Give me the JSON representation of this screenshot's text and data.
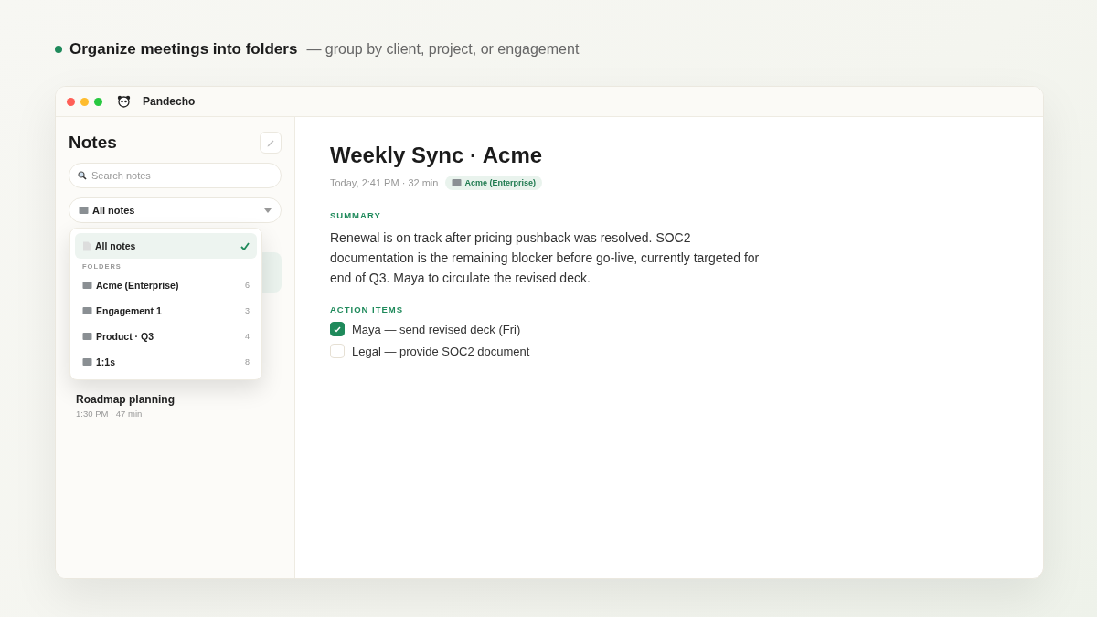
{
  "headline": {
    "title": "Organize meetings into folders",
    "subtitle": "— group by client, project, or engagement"
  },
  "window": {
    "title": "Pandecho"
  },
  "sidebar": {
    "title": "Notes",
    "search": {
      "placeholder": "Search notes"
    },
    "filter": {
      "value": "All notes",
      "expanded": true
    },
    "notes": [
      {
        "title": "Roadmap planning",
        "meta": "1:30 PM · 47 min"
      }
    ]
  },
  "dropdown": {
    "all": {
      "label": "All notes",
      "selected": true
    },
    "section": "FOLDERS",
    "folders": [
      {
        "label": "Acme (Enterprise)",
        "count": "6",
        "selected": false
      },
      {
        "label": "Engagement 1",
        "count": "3",
        "selected": false
      },
      {
        "label": "Product · Q3",
        "count": "4",
        "selected": false
      },
      {
        "label": "1:1s",
        "count": "8",
        "selected": false
      }
    ]
  },
  "note": {
    "title": "Weekly Sync · Acme",
    "meta": "Today, 2:41 PM · 32 min",
    "tag": "Acme (Enterprise)",
    "summary_heading": "SUMMARY",
    "summary": "Renewal is on track after pricing pushback was resolved. SOC2 documentation is the remaining blocker before go-live, currently targeted for end of Q3. Maya to circulate the revised deck.",
    "actions_heading": "ACTION ITEMS",
    "actions": [
      {
        "text": "Maya — send revised deck (Fri)",
        "checked": true
      },
      {
        "text": "Legal — provide SOC2 document",
        "checked": false
      }
    ]
  }
}
